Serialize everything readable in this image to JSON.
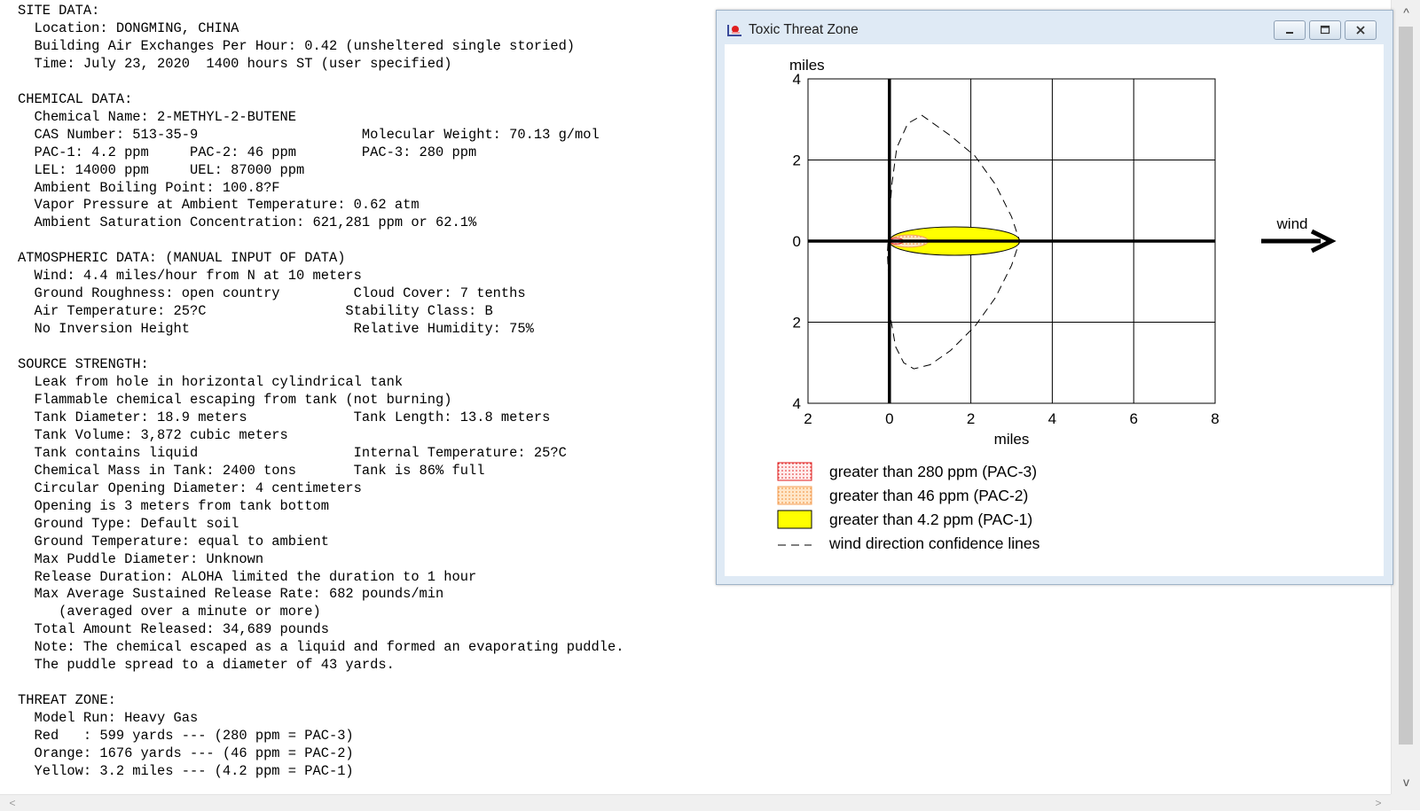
{
  "report": {
    "lines": [
      "SITE DATA:",
      "  Location: DONGMING, CHINA",
      "  Building Air Exchanges Per Hour: 0.42 (unsheltered single storied)",
      "  Time: July 23, 2020  1400 hours ST (user specified)",
      "",
      "CHEMICAL DATA:",
      "  Chemical Name: 2-METHYL-2-BUTENE",
      "  CAS Number: 513-35-9                    Molecular Weight: 70.13 g/mol",
      "  PAC-1: 4.2 ppm     PAC-2: 46 ppm        PAC-3: 280 ppm",
      "  LEL: 14000 ppm     UEL: 87000 ppm",
      "  Ambient Boiling Point: 100.8?F",
      "  Vapor Pressure at Ambient Temperature: 0.62 atm",
      "  Ambient Saturation Concentration: 621,281 ppm or 62.1%",
      "",
      "ATMOSPHERIC DATA: (MANUAL INPUT OF DATA)",
      "  Wind: 4.4 miles/hour from N at 10 meters",
      "  Ground Roughness: open country         Cloud Cover: 7 tenths",
      "  Air Temperature: 25?C                 Stability Class: B",
      "  No Inversion Height                    Relative Humidity: 75%",
      "",
      "SOURCE STRENGTH:",
      "  Leak from hole in horizontal cylindrical tank",
      "  Flammable chemical escaping from tank (not burning)",
      "  Tank Diameter: 18.9 meters             Tank Length: 13.8 meters",
      "  Tank Volume: 3,872 cubic meters",
      "  Tank contains liquid                   Internal Temperature: 25?C",
      "  Chemical Mass in Tank: 2400 tons       Tank is 86% full",
      "  Circular Opening Diameter: 4 centimeters",
      "  Opening is 3 meters from tank bottom",
      "  Ground Type: Default soil",
      "  Ground Temperature: equal to ambient",
      "  Max Puddle Diameter: Unknown",
      "  Release Duration: ALOHA limited the duration to 1 hour",
      "  Max Average Sustained Release Rate: 682 pounds/min",
      "     (averaged over a minute or more)",
      "  Total Amount Released: 34,689 pounds",
      "  Note: The chemical escaped as a liquid and formed an evaporating puddle.",
      "  The puddle spread to a diameter of 43 yards.",
      "",
      "THREAT ZONE:",
      "  Model Run: Heavy Gas",
      "  Red   : 599 yards --- (280 ppm = PAC-3)",
      "  Orange: 1676 yards --- (46 ppm = PAC-2)",
      "  Yellow: 3.2 miles --- (4.2 ppm = PAC-1)"
    ]
  },
  "window": {
    "title": "Toxic Threat Zone",
    "icon": "chart-app-icon",
    "buttons": {
      "minimize": "minimize-icon",
      "maximize": "maximize-icon",
      "close": "close-icon"
    }
  },
  "scrollbars": {
    "up_glyph": "^",
    "down_glyph": "v",
    "left_glyph": "<",
    "right_glyph": ">"
  },
  "chart_data": {
    "type": "area",
    "ylabel": "miles",
    "xlabel": "miles",
    "xlim": [
      -2,
      8
    ],
    "ylim": [
      -4,
      4
    ],
    "x_ticks": [
      -2,
      0,
      2,
      4,
      6,
      8
    ],
    "x_tick_labels": [
      "2",
      "0",
      "2",
      "4",
      "6",
      "8"
    ],
    "y_ticks": [
      4,
      2,
      0,
      -2,
      -4
    ],
    "y_tick_labels": [
      "4",
      "2",
      "0",
      "2",
      "4"
    ],
    "grid": true,
    "wind_label": "wind",
    "zones": [
      {
        "name": "greater than 280 ppm (PAC-3)",
        "level": "PAC-3",
        "length_miles": 0.34,
        "half_width_miles": 0.07,
        "color": "#e02020",
        "fill": "#ffe3e3",
        "pattern": "dotted"
      },
      {
        "name": "greater than 46 ppm (PAC-2)",
        "level": "PAC-2",
        "length_miles": 0.95,
        "half_width_miles": 0.15,
        "color": "#f5a05a",
        "fill": "#ffd7aa",
        "pattern": "dotted"
      },
      {
        "name": "greater than 4.2 ppm (PAC-1)",
        "level": "PAC-1",
        "length_miles": 3.2,
        "half_width_miles": 0.35,
        "color": "#000000",
        "fill": "#ffff00",
        "pattern": "solid"
      }
    ],
    "confidence_lines": {
      "name": "wind direction confidence lines",
      "points": [
        [
          0,
          -1.3
        ],
        [
          0.03,
          -1.9
        ],
        [
          0.15,
          -2.6
        ],
        [
          0.35,
          -3.0
        ],
        [
          0.6,
          -3.15
        ],
        [
          1.0,
          -3.05
        ],
        [
          1.5,
          -2.7
        ],
        [
          2.1,
          -2.1
        ],
        [
          2.6,
          -1.4
        ],
        [
          3.0,
          -0.6
        ],
        [
          3.2,
          0
        ],
        [
          3.0,
          0.6
        ],
        [
          2.6,
          1.4
        ],
        [
          2.1,
          2.1
        ],
        [
          1.5,
          2.6
        ],
        [
          0.8,
          3.1
        ],
        [
          0.45,
          2.9
        ],
        [
          0.18,
          2.3
        ],
        [
          0.06,
          1.4
        ],
        [
          0,
          0.6
        ],
        [
          -0.05,
          -0.3
        ],
        [
          0,
          -1.3
        ]
      ],
      "color": "#000000",
      "style": "dashed"
    },
    "legend": [
      {
        "label": "greater than 280 ppm (PAC-3)",
        "swatch": "pac3"
      },
      {
        "label": "greater than 46 ppm (PAC-2)",
        "swatch": "pac2"
      },
      {
        "label": "greater than 4.2 ppm (PAC-1)",
        "swatch": "pac1"
      },
      {
        "label": "wind direction confidence lines",
        "swatch": "dashed"
      }
    ]
  }
}
